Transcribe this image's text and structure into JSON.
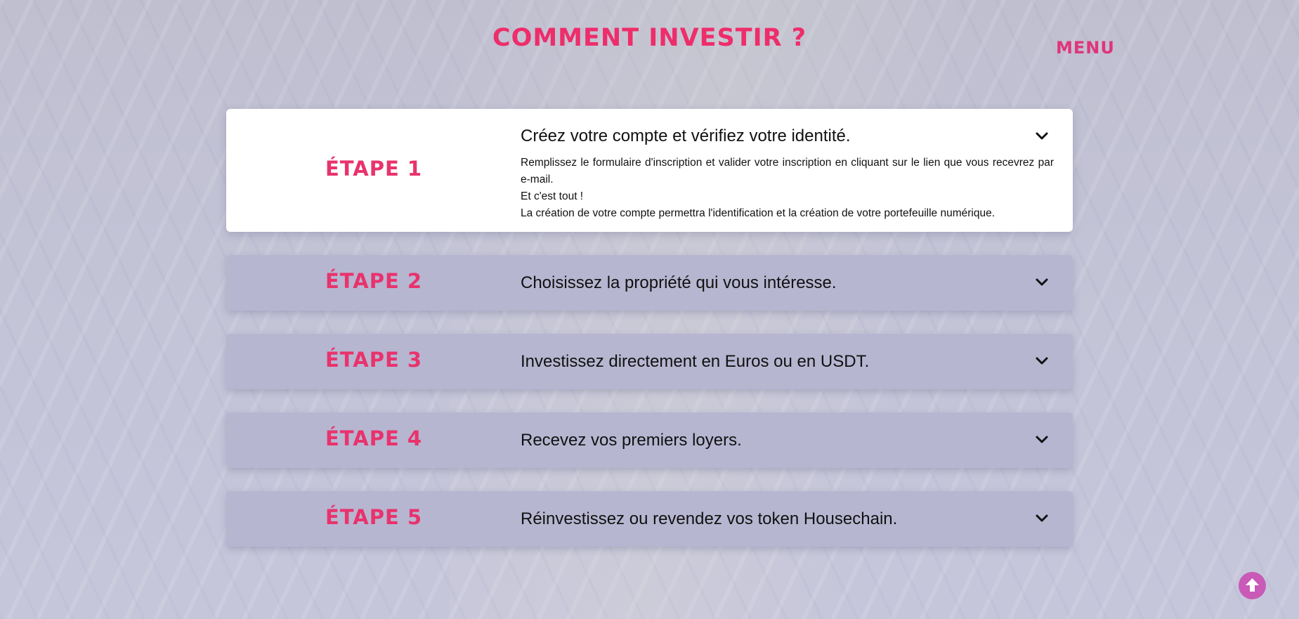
{
  "header": {
    "title": "COMMENT INVESTIR ?",
    "menu_label": "MENU"
  },
  "steps": [
    {
      "label": "ÉTAPE 1",
      "title": "Créez votre compte et vérifiez votre identité.",
      "expanded": true,
      "description": [
        "Remplissez le formulaire d'inscription et valider votre inscription en cliquant sur le lien que vous recevrez par e-mail.",
        "Et c'est tout !",
        "La création de votre compte permettra l'identification et la création de votre portefeuille numérique."
      ]
    },
    {
      "label": "ÉTAPE 2",
      "title": "Choisissez la propriété qui vous intéresse.",
      "expanded": false
    },
    {
      "label": "ÉTAPE 3",
      "title": "Investissez directement en Euros ou en USDT.",
      "expanded": false
    },
    {
      "label": "ÉTAPE 4",
      "title": "Recevez vos premiers loyers.",
      "expanded": false
    },
    {
      "label": "ÉTAPE 5",
      "title": "Réinvestissez ou revendez vos token Housechain.",
      "expanded": false
    }
  ],
  "icons": {
    "chevron": "chevron-down-icon",
    "scroll_top": "arrow-up-circle-icon"
  },
  "colors": {
    "accent": "#ee2d6b",
    "scroll_button": "#c95ab7",
    "collapsed_card": "#b7b6d1",
    "expanded_card": "#ffffff"
  }
}
